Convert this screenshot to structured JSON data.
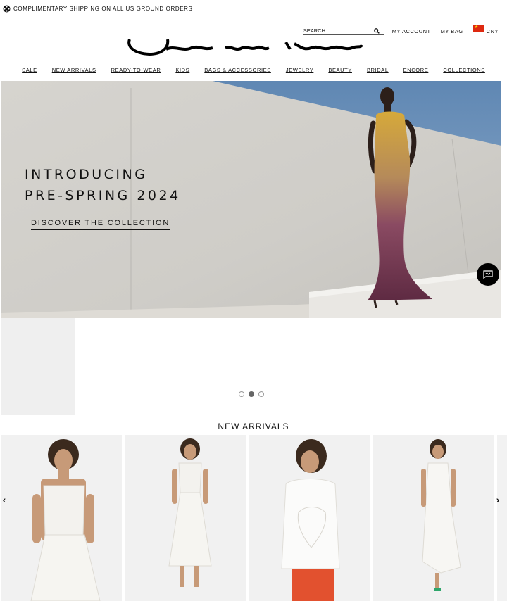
{
  "promo": {
    "text": "COMPLIMENTARY SHIPPING ON ALL US GROUND ORDERS"
  },
  "utility": {
    "search_placeholder": "SEARCH",
    "my_account": "MY ACCOUNT",
    "my_bag": "MY BAG",
    "currency": "CNY"
  },
  "nav": {
    "items": [
      "SALE",
      "NEW ARRIVALS",
      "READY-TO-WEAR",
      "KIDS",
      "BAGS & ACCESSORIES",
      "JEWELRY",
      "BEAUTY",
      "BRIDAL",
      "ENCORE",
      "COLLECTIONS"
    ]
  },
  "hero": {
    "title_line1": "INTRODUCING",
    "title_line2": "PRE-SPRING 2024",
    "cta": "DISCOVER THE COLLECTION"
  },
  "carousel": {
    "slides": 3,
    "active_index": 2
  },
  "new_arrivals": {
    "title": "NEW ARRIVALS"
  },
  "colors": {
    "sky": "#6f93bb",
    "wall": "#d3d1cc",
    "accent": "#000000"
  },
  "icons": {
    "promo": "shipping-icon",
    "search": "search-icon",
    "chat": "chat-icon",
    "prev": "chevron-left-icon",
    "next": "chevron-right-icon"
  }
}
